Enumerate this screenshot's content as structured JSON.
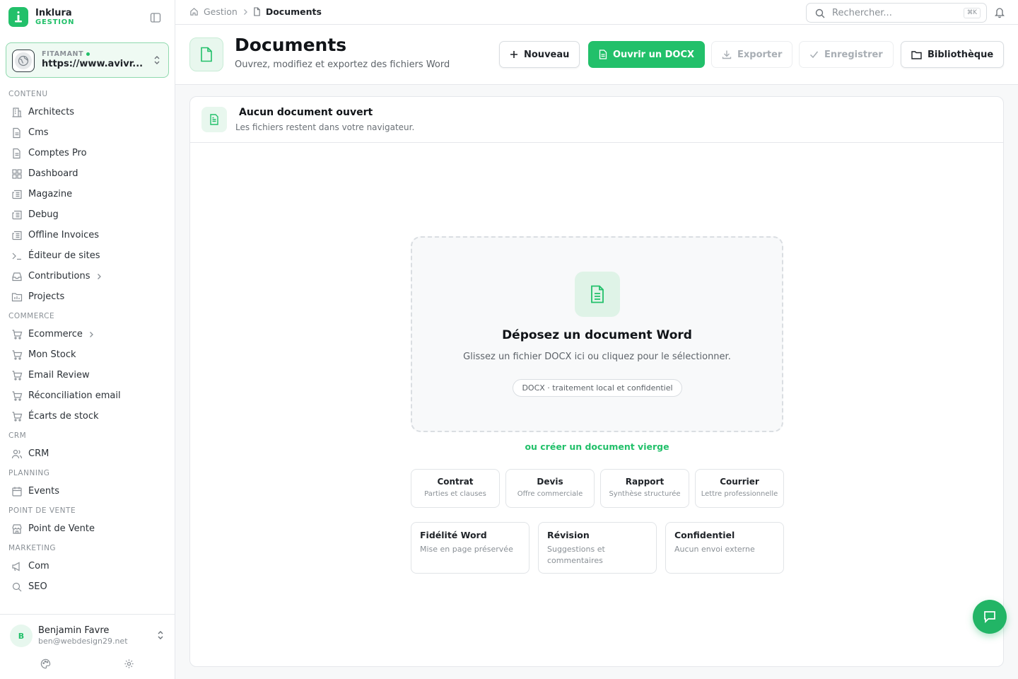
{
  "brand": {
    "name": "Inklura",
    "subtitle": "GESTION",
    "accent": "#22c06a"
  },
  "site": {
    "label": "FITAMANT",
    "url": "https://www.avivr..."
  },
  "nav": {
    "sections": [
      {
        "title": "CONTENU",
        "items": [
          {
            "label": "Architects",
            "icon": "building-icon"
          },
          {
            "label": "Cms",
            "icon": "file-icon"
          },
          {
            "label": "Comptes Pro",
            "icon": "file-icon"
          },
          {
            "label": "Dashboard",
            "icon": "grid-icon"
          },
          {
            "label": "Magazine",
            "icon": "newspaper-icon"
          },
          {
            "label": "Debug",
            "icon": "newspaper-icon"
          },
          {
            "label": "Offline Invoices",
            "icon": "newspaper-icon"
          },
          {
            "label": "Éditeur de sites",
            "icon": "terminal-icon"
          },
          {
            "label": "Contributions",
            "icon": "inbox-icon",
            "chevron": true
          },
          {
            "label": "Projects",
            "icon": "folder-icon"
          }
        ]
      },
      {
        "title": "COMMERCE",
        "items": [
          {
            "label": "Ecommerce",
            "icon": "cart-icon",
            "chevron": true
          },
          {
            "label": "Mon Stock",
            "icon": "cart-icon"
          },
          {
            "label": "Email Review",
            "icon": "cart-icon"
          },
          {
            "label": "Réconciliation email",
            "icon": "cart-icon"
          },
          {
            "label": "Écarts de stock",
            "icon": "cart-icon"
          }
        ]
      },
      {
        "title": "CRM",
        "items": [
          {
            "label": "CRM",
            "icon": "users-icon"
          }
        ]
      },
      {
        "title": "PLANNING",
        "items": [
          {
            "label": "Events",
            "icon": "calendar-icon"
          }
        ]
      },
      {
        "title": "POINT DE VENTE",
        "items": [
          {
            "label": "Point de Vente",
            "icon": "store-icon"
          }
        ]
      },
      {
        "title": "MARKETING",
        "items": [
          {
            "label": "Com",
            "icon": "megaphone-icon"
          },
          {
            "label": "SEO",
            "icon": "search-icon"
          }
        ]
      }
    ]
  },
  "user": {
    "initial": "B",
    "name": "Benjamin Favre",
    "email": "ben@webdesign29.net"
  },
  "topbar": {
    "breadcrumb": [
      "Gestion",
      "Documents"
    ],
    "search_placeholder": "Rechercher...",
    "search_shortcut": "⌘K"
  },
  "header": {
    "title": "Documents",
    "subtitle": "Ouvrez, modifiez et exportez des fichiers Word",
    "buttons": {
      "new": "Nouveau",
      "open": "Ouvrir un DOCX",
      "export": "Exporter",
      "save": "Enregistrer",
      "library": "Bibliothèque"
    }
  },
  "card": {
    "title": "Aucun document ouvert",
    "subtitle": "Les fichiers restent dans votre navigateur."
  },
  "dropzone": {
    "title": "Déposez un document Word",
    "subtitle": "Glissez un fichier DOCX ici ou cliquez pour le sélectionner.",
    "badge": "DOCX · traitement local et confidentiel"
  },
  "create_link": "ou créer un document vierge",
  "templates": [
    {
      "title": "Contrat",
      "sub": "Parties et clauses"
    },
    {
      "title": "Devis",
      "sub": "Offre commerciale"
    },
    {
      "title": "Rapport",
      "sub": "Synthèse structurée"
    },
    {
      "title": "Courrier",
      "sub": "Lettre professionnelle"
    }
  ],
  "features": [
    {
      "title": "Fidélité Word",
      "sub": "Mise en page préservée"
    },
    {
      "title": "Révision",
      "sub": "Suggestions et commentaires"
    },
    {
      "title": "Confidentiel",
      "sub": "Aucun envoi externe"
    }
  ]
}
